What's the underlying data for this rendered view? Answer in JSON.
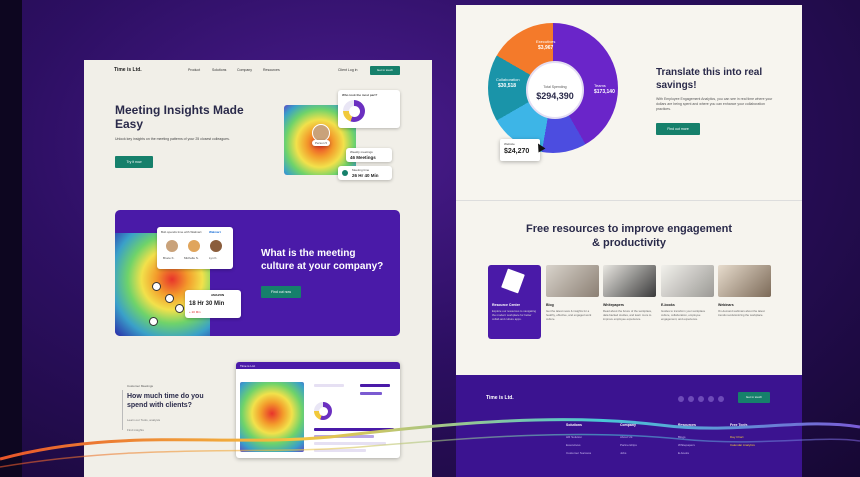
{
  "left_page": {
    "nav": {
      "logo": "Time is Ltd.",
      "items": [
        "Product",
        "Solutions",
        "Company",
        "Resources"
      ],
      "login": "Client Log in",
      "cta": "Get in touch"
    },
    "hero": {
      "title": "Meeting Insights Made Easy",
      "subtitle": "Unlock key insights on the meeting patterns of your 25 closest colleagues.",
      "button": "Try it now",
      "card_title": "Who took the most part?",
      "card_meetings_label": "Weekly meetings",
      "card_meetings_value": "46 Meetings",
      "card_time_label": "Meeting time",
      "card_time_value": "26 Hr 40 Min",
      "person_label": "Person 5"
    },
    "band": {
      "title": "What is the meeting culture at your company?",
      "button": "Find out now",
      "card_label": "Bob spends time with Walmart",
      "brand_a": "Walmart",
      "brand_b": "AMAZON",
      "time_value": "18 Hr 30 Min",
      "time_delta": "+ 20 Min",
      "people": [
        "Bruce K.",
        "Michelle S.",
        "Lyn K."
      ]
    },
    "question": {
      "tag": "Customer Meetings",
      "title": "How much time do you spend with clients?",
      "link1": "Learn our Tools, analysis",
      "link2": "Find insights"
    },
    "dashboard": {
      "logo": "Time is Ltd."
    }
  },
  "right_page": {
    "donut": {
      "total_label": "Total Spending",
      "total_value": "$294,390",
      "seg_top_label": "Executives",
      "seg_top_value": "$3,967",
      "seg_left_label": "Collaboration",
      "seg_left_value": "$30,518",
      "seg_right_label": "Teams",
      "seg_right_value": "$173,140",
      "popup_label": "Website",
      "popup_value": "$24,270"
    },
    "savings": {
      "title": "Translate this into real savings!",
      "text": "With Employee Engagement Analytics, you can see in real time where your dollars are being spent and where you can enhance your collaboration practices.",
      "button": "Find out more"
    },
    "resources": {
      "title": "Free resources to improve engagement & productivity",
      "cards": [
        {
          "name": "Resource Center",
          "desc": "Explore our resources to navigating the modern workplace for better collab and culture apps."
        },
        {
          "name": "Blog",
          "desc": "Get the latest news & insights for a healthy, effective, and engaged work culture."
        },
        {
          "name": "Whitepapers",
          "desc": "Read about the future of the workplace, data backed studies, and learn more to improve employee experience."
        },
        {
          "name": "E-books",
          "desc": "Guides to transform your workplace culture, collaboration, employee engagement, and experience."
        },
        {
          "name": "Webinars",
          "desc": "On-demand webinars about the latest trends revolutionizing the workplace."
        }
      ]
    },
    "footer": {
      "logo": "Time is Ltd.",
      "button": "Get in touch",
      "columns": [
        {
          "title": "Solutions",
          "items": [
            "HR Solution",
            "Executives",
            "Customer Success"
          ]
        },
        {
          "title": "Company",
          "items": [
            "About Us",
            "Partnerships",
            "Jobs"
          ]
        },
        {
          "title": "Resources",
          "items": [
            "Blogs",
            "Whitepapers",
            "E-books"
          ]
        },
        {
          "title": "Free Tools",
          "items": [
            "Day Chart",
            "Calendar Analytics"
          ]
        }
      ]
    }
  },
  "colors": {
    "accent_green": "#16806b",
    "brand_purple": "#4a1aa8",
    "background": "#2d0f63"
  }
}
